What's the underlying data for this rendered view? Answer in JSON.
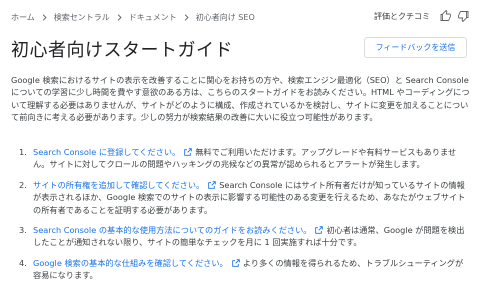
{
  "breadcrumb": {
    "items": [
      "ホーム",
      "検索セントラル",
      "ドキュメント",
      "初心者向け SEO"
    ]
  },
  "header": {
    "rating_label": "評価とクチコミ",
    "icons": [
      "thumb-up-icon",
      "thumb-down-icon"
    ]
  },
  "page": {
    "title": "初心者向けスタートガイド",
    "feedback_button": "フィードバックを送信",
    "intro": "Google 検索におけるサイトの表示を改善することに関心をお持ちの方や、検索エンジン最適化（SEO）と Search Console についての学習に少し時間を費やす意欲のある方は、こちらのスタートガイドをお読みください。HTML やコーディングについて理解する必要はありませんが、サイトがどのように構成、作成されているかを検討し、サイトに変更を加えることについて前向きに考える必要があります。少しの努力が検索結果の改善に大いに役立つ可能性があります。"
  },
  "steps": [
    {
      "number": "1.",
      "link": "Search Console に登録してください。",
      "text": "無料でご利用いただけます。アップグレードや有料サービスもありません。サイトに対してクロールの問題やハッキングの兆候などの異常が認められるとアラートが発生します。"
    },
    {
      "number": "2.",
      "link": "サイトの所有権を追加して確認してください。",
      "text": "Search Console にはサイト所有者だけが知っているサイトの情報が表示されるほか、Google 検索でのサイトの表示に影響する可能性のある変更を行えるため、あなたがウェブサイトの所有者であることを証明する必要があります。"
    },
    {
      "number": "3.",
      "link": "Search Console の基本的な使用方法についてのガイドをお読みください。",
      "text": "初心者は通常、Google が問題を検出したことが通知されない限り、サイトの簡単なチェックを月に 1 回実施すれば十分です。"
    },
    {
      "number": "4.",
      "link": "Google 検索の基本的な仕組みを確認してください。",
      "text": "より多くの情報を得られるため、トラブルシューティングが容易になります。"
    }
  ],
  "colors": {
    "link": "#1a73e8",
    "text": "#3c4043",
    "title": "#202124",
    "border": "#dadce0"
  }
}
